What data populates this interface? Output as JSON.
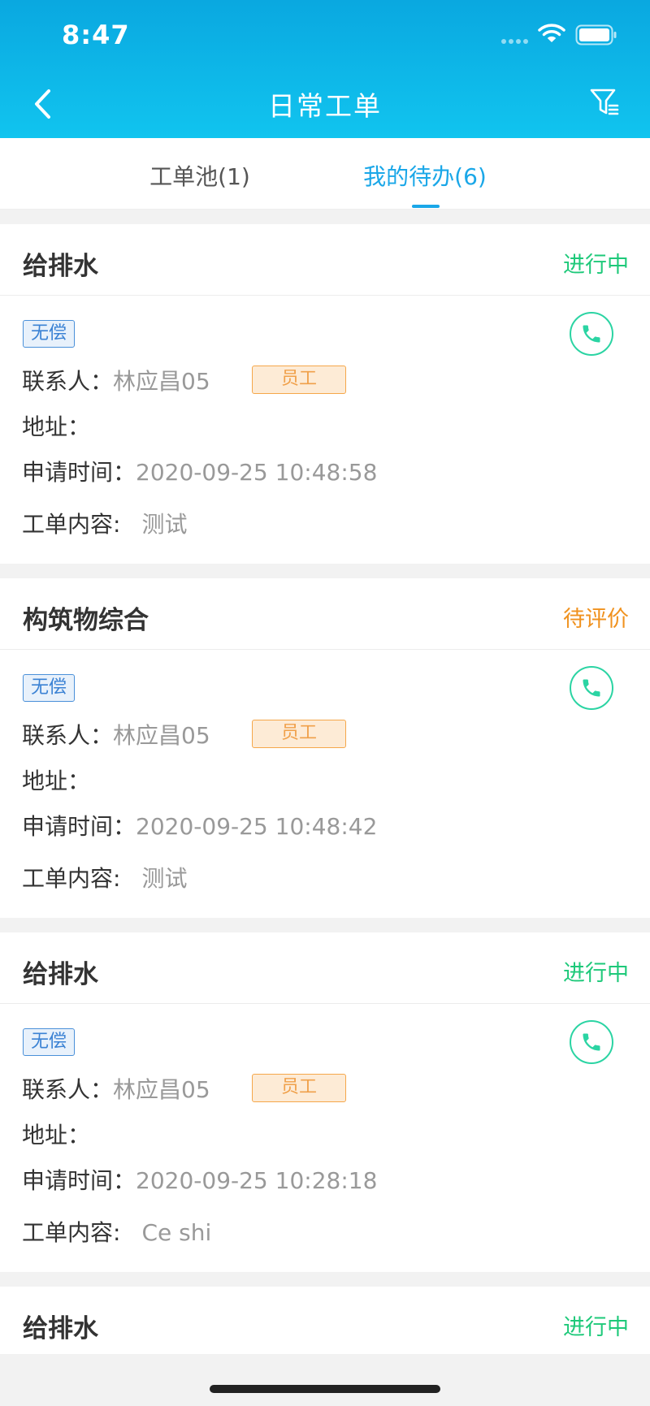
{
  "status_bar": {
    "time": "8:47"
  },
  "header": {
    "title": "日常工单"
  },
  "tabs": [
    {
      "label": "工单池(1)",
      "active": false
    },
    {
      "label": "我的待办(6)",
      "active": true
    }
  ],
  "colors": {
    "accent": "#1aa7e8",
    "status_in_progress": "#1ec97a",
    "status_pending_review": "#f0921f",
    "phone": "#2bd4a3"
  },
  "labels": {
    "contact": "联系人：",
    "address": "地址：",
    "apply_time": "申请时间：",
    "content": "工单内容:"
  },
  "orders": [
    {
      "title": "给排水",
      "status": "进行中",
      "tag": "无偿",
      "contact": "林应昌05",
      "role": "员工",
      "address": "",
      "apply_time": "2020-09-25 10:48:58",
      "content": "测试"
    },
    {
      "title": "构筑物综合",
      "status": "待评价",
      "tag": "无偿",
      "contact": "林应昌05",
      "role": "员工",
      "address": "",
      "apply_time": "2020-09-25 10:48:42",
      "content": "测试"
    },
    {
      "title": "给排水",
      "status": "进行中",
      "tag": "无偿",
      "contact": "林应昌05",
      "role": "员工",
      "address": "",
      "apply_time": "2020-09-25 10:28:18",
      "content": "Ce shi"
    },
    {
      "title": "给排水",
      "status": "进行中"
    }
  ]
}
